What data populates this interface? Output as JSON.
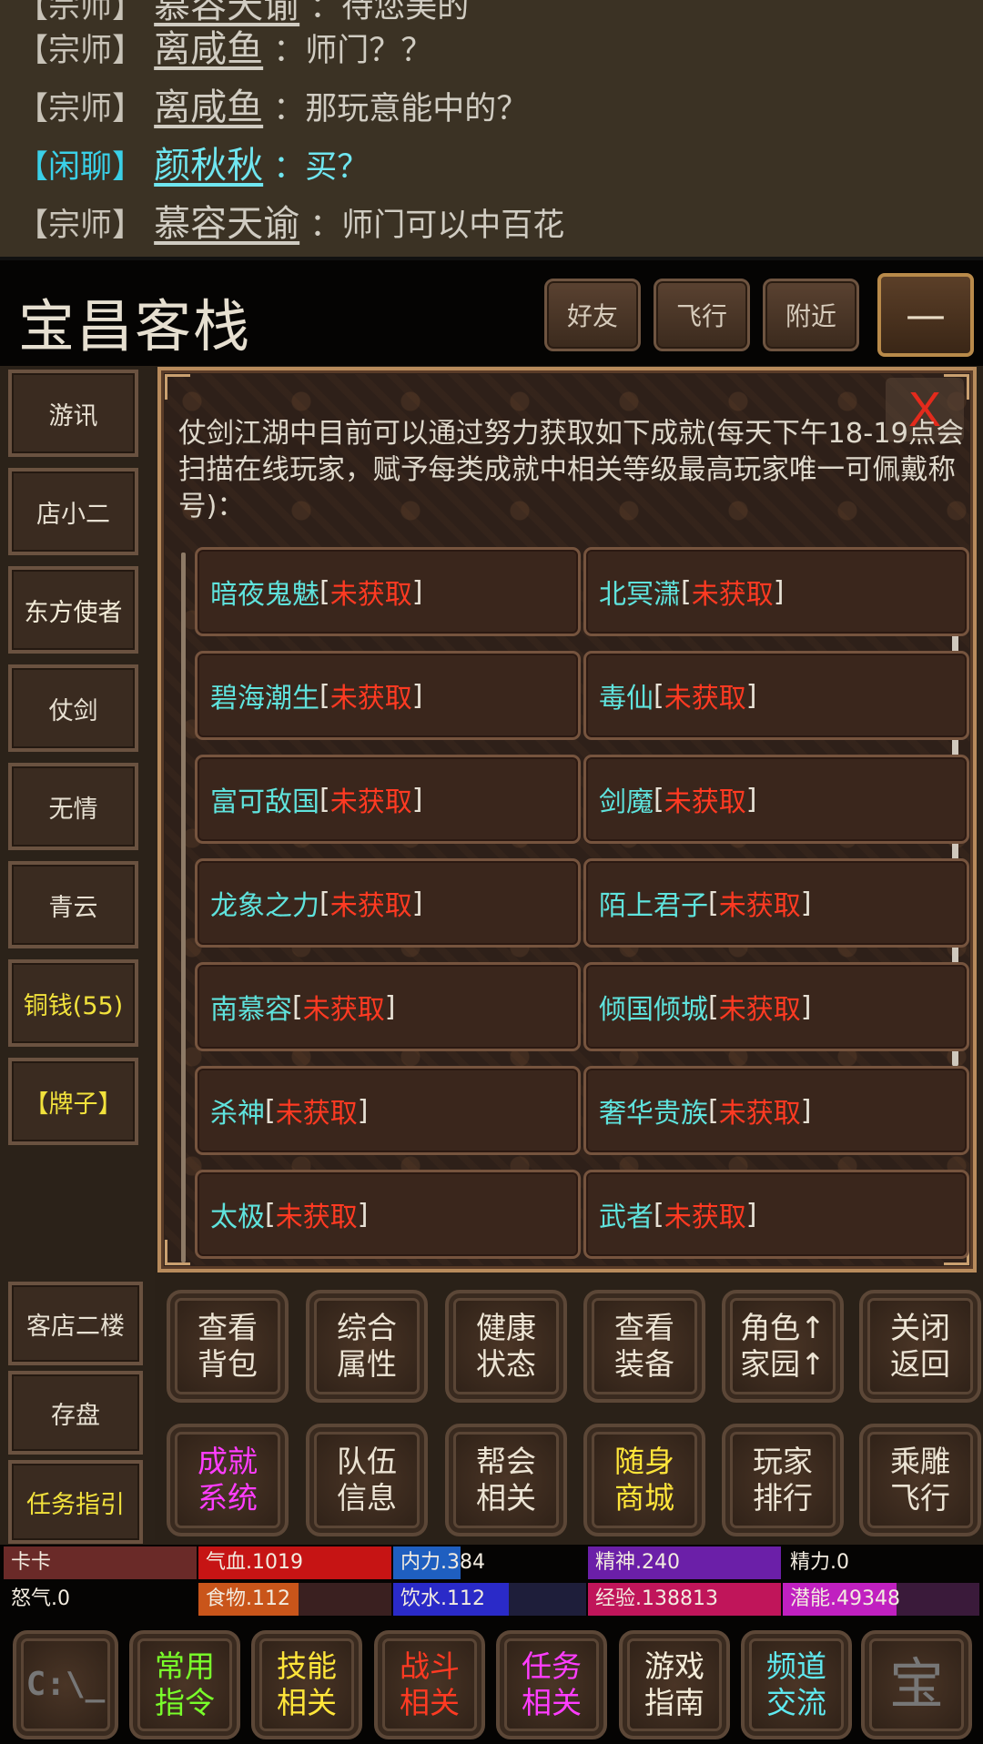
{
  "chat": {
    "lines": [
      {
        "channel": "【宗师】",
        "name": "慕容天谕",
        "message": "：待您美的"
      },
      {
        "channel": "【宗师】",
        "name": "离咸鱼",
        "message": "：师门？？"
      },
      {
        "channel": "【宗师】",
        "name": "离咸鱼",
        "message": "：那玩意能中的？"
      },
      {
        "channel": "【闲聊】",
        "name": "颜秋秋",
        "message": "：买？"
      },
      {
        "channel": "【宗师】",
        "name": "慕容天谕",
        "message": "：师门可以中百花"
      }
    ]
  },
  "header": {
    "location": "宝昌客栈",
    "buttons": {
      "friends": "好友",
      "fly": "飞行",
      "nearby": "附近",
      "minimize": "—"
    }
  },
  "sidebar": {
    "items": [
      "游讯",
      "店小二",
      "东方使者",
      "仗剑",
      "无情",
      "青云",
      "铜钱(55)",
      "【牌子】"
    ],
    "bottom_items": [
      "客店二楼",
      "存盘",
      "任务指引"
    ]
  },
  "panel": {
    "close": "X",
    "intro": "仗剑江湖中目前可以通过努力获取如下成就(每天下午18-19点会扫描在线玩家，赋予每类成就中相关等级最高玩家唯一可佩戴称号)：",
    "status_label": "未获取",
    "achievements": [
      {
        "name": "暗夜鬼魅",
        "status": "未获取"
      },
      {
        "name": "北冥潇",
        "status": "未获取"
      },
      {
        "name": "碧海潮生",
        "status": "未获取"
      },
      {
        "name": "毒仙",
        "status": "未获取"
      },
      {
        "name": "富可敌国",
        "status": "未获取"
      },
      {
        "name": "剑魔",
        "status": "未获取"
      },
      {
        "name": "龙象之力",
        "status": "未获取"
      },
      {
        "name": "陌上君子",
        "status": "未获取"
      },
      {
        "name": "南慕容",
        "status": "未获取"
      },
      {
        "name": "倾国倾城",
        "status": "未获取"
      },
      {
        "name": "杀神",
        "status": "未获取"
      },
      {
        "name": "奢华贵族",
        "status": "未获取"
      },
      {
        "name": "太极",
        "status": "未获取"
      },
      {
        "name": "武者",
        "status": "未获取"
      }
    ]
  },
  "actions": {
    "row1": [
      {
        "l1": "查看",
        "l2": "背包"
      },
      {
        "l1": "综合",
        "l2": "属性"
      },
      {
        "l1": "健康",
        "l2": "状态"
      },
      {
        "l1": "查看",
        "l2": "装备"
      },
      {
        "l1": "角色↑",
        "l2": "家园↑"
      },
      {
        "l1": "关闭",
        "l2": "返回"
      }
    ],
    "row2": [
      {
        "l1": "成就",
        "l2": "系统"
      },
      {
        "l1": "队伍",
        "l2": "信息"
      },
      {
        "l1": "帮会",
        "l2": "相关"
      },
      {
        "l1": "随身",
        "l2": "商城"
      },
      {
        "l1": "玩家",
        "l2": "排行"
      },
      {
        "l1": "乘雕",
        "l2": "飞行"
      }
    ]
  },
  "stats": {
    "player": "卡卡",
    "hp": "气血.1019",
    "mp": "内力.384",
    "spirit": "精神.240",
    "energy": "精力.0",
    "rage": "怒气.0",
    "food": "食物.112",
    "water": "饮水.112",
    "exp": "经验.138813",
    "potential": "潜能.49348",
    "fills": {
      "player": 1.0,
      "hp": 1.0,
      "mp": 0.35,
      "spirit": 1.0,
      "food": 0.52,
      "water": 0.6,
      "exp": 1.0,
      "potential": 0.58
    },
    "colors": {
      "player": "#6a2a28",
      "hp": "#c61414",
      "mp": "#1f5fc0",
      "spirit": "#6b1fa8",
      "food": "#c9551a",
      "water": "#2a2ac8",
      "exp": "#c0155a",
      "potential": "#c020c0"
    }
  },
  "footer": {
    "console": "C:\\_",
    "buttons": [
      {
        "l1": "常用",
        "l2": "指令"
      },
      {
        "l1": "技能",
        "l2": "相关"
      },
      {
        "l1": "战斗",
        "l2": "相关"
      },
      {
        "l1": "任务",
        "l2": "相关"
      },
      {
        "l1": "游戏",
        "l2": "指南"
      },
      {
        "l1": "频道",
        "l2": "交流"
      }
    ],
    "last": "宝"
  }
}
